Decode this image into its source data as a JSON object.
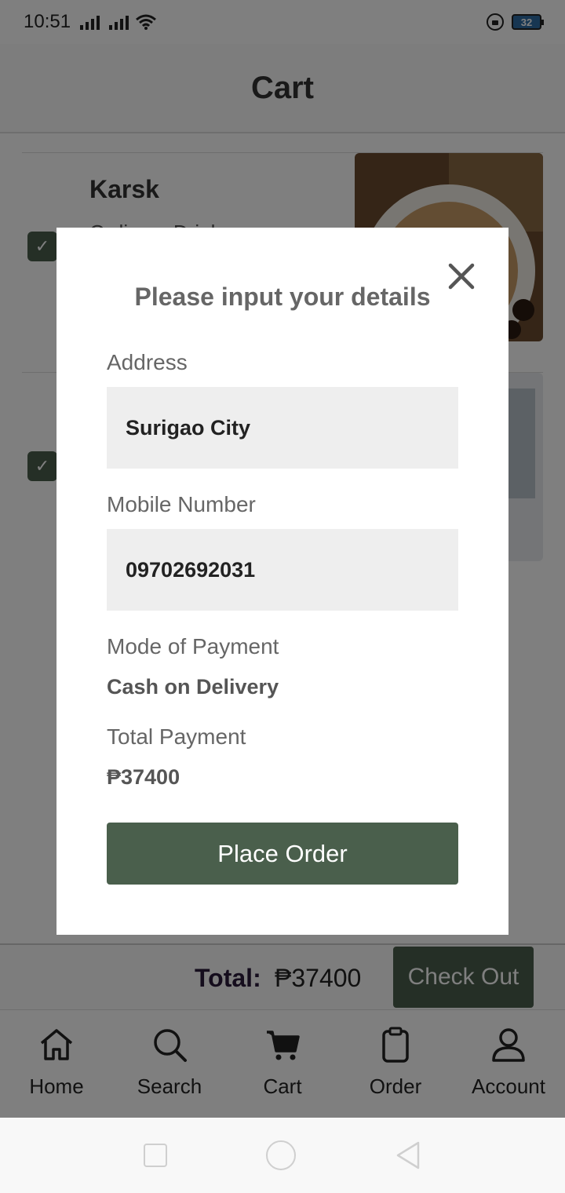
{
  "status_bar": {
    "time": "10:51",
    "battery": "32"
  },
  "header": {
    "title": "Cart"
  },
  "cart": {
    "items": [
      {
        "name": "Karsk",
        "category": "Ordinary Drink"
      },
      {
        "name": "",
        "category": ""
      }
    ]
  },
  "footer": {
    "total_label": "Total:",
    "total_amount": "₱37400",
    "checkout_label": "Check Out"
  },
  "tabs": [
    {
      "label": "Home",
      "icon": "home-icon"
    },
    {
      "label": "Search",
      "icon": "search-icon"
    },
    {
      "label": "Cart",
      "icon": "cart-icon"
    },
    {
      "label": "Order",
      "icon": "clipboard-icon"
    },
    {
      "label": "Account",
      "icon": "person-icon"
    }
  ],
  "modal": {
    "title": "Please input your details",
    "address_label": "Address",
    "address_value": "Surigao City",
    "mobile_label": "Mobile Number",
    "mobile_value": "09702692031",
    "payment_label": "Mode of Payment",
    "payment_value": "Cash on Delivery",
    "total_label": "Total Payment",
    "total_value": "₱37400",
    "place_order_label": "Place Order"
  },
  "colors": {
    "accent": "#4a5f4c",
    "overlay": "rgba(0,0,0,0.5)"
  }
}
